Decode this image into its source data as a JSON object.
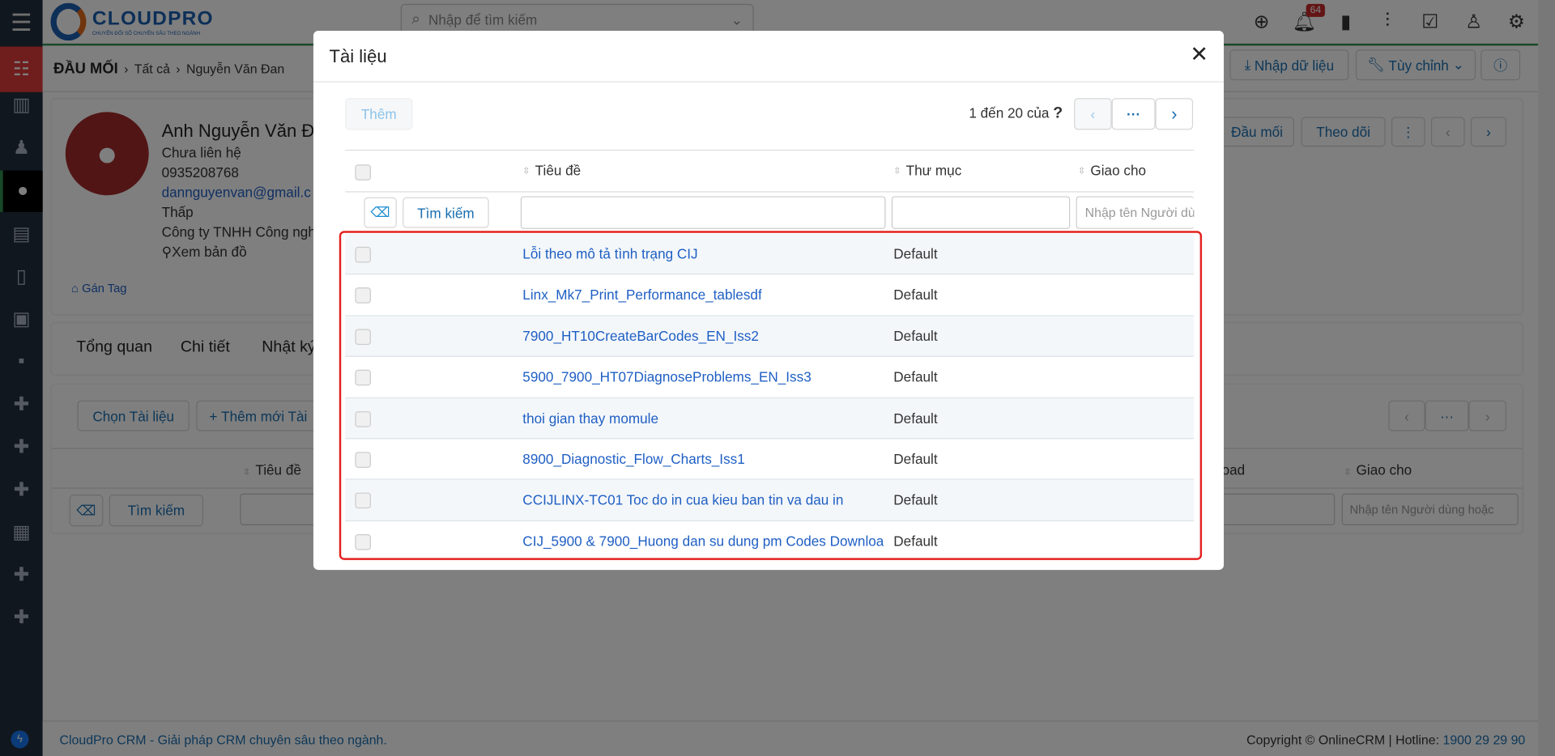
{
  "app": {
    "logo_text": "CLOUDPRO",
    "logo_tagline": "CHUYỂN ĐỔI SỐ CHUYÊN SÂU THEO NGÀNH",
    "search_placeholder": "Nhập để tìm kiếm",
    "notification_count": "64"
  },
  "breadcrumb": [
    "ĐẦU MỐI",
    "Tất cả",
    "Nguyễn Văn Đan"
  ],
  "header_buttons": {
    "import": "Nhập dữ liệu",
    "customize": "Tùy chỉnh"
  },
  "profile": {
    "name": "Anh Nguyễn Văn Đ",
    "status": "Chưa liên hệ",
    "phone": "0935208768",
    "email": "dannguyenvan@gmail.c",
    "priority": "Thấp",
    "company": "Công ty TNHH Công ngh",
    "map": "Xem bản đồ",
    "tag": "Gán Tag",
    "btn_lead": "Đầu mối",
    "btn_follow": "Theo dõi"
  },
  "tabs": [
    "Tổng quan",
    "Chi tiết",
    "Nhật ký"
  ],
  "docs_section": {
    "choose": "Chọn Tài liệu",
    "add_new": "Thêm mới Tài",
    "col_title": "Tiêu đề",
    "col_download": "oad",
    "col_assign": "Giao cho",
    "search": "Tìm kiếm",
    "assign_placeholder": "Nhập tên Người dùng hoặc"
  },
  "footer": {
    "left": "CloudPro CRM - Giải pháp CRM chuyên sâu theo ngành.",
    "right": "Copyright © OnlineCRM | Hotline: ",
    "hotline": "1900 29 29 90"
  },
  "modal": {
    "title": "Tài liệu",
    "add": "Thêm",
    "pagination": "1 đến 20 của",
    "pagination_total": "?",
    "dots": "···",
    "columns": {
      "title": "Tiêu đề",
      "folder": "Thư mục",
      "assign": "Giao cho"
    },
    "search": "Tìm kiếm",
    "assign_placeholder": "Nhập tên Người dùng",
    "rows": [
      {
        "title": "Lỗi theo mô tả tình trạng CIJ",
        "folder": "Default"
      },
      {
        "title": "Linx_Mk7_Print_Performance_tablesdf",
        "folder": "Default"
      },
      {
        "title": "7900_HT10CreateBarCodes_EN_Iss2",
        "folder": "Default"
      },
      {
        "title": "5900_7900_HT07DiagnoseProblems_EN_Iss3",
        "folder": "Default"
      },
      {
        "title": "thoi gian thay momule",
        "folder": "Default"
      },
      {
        "title": "8900_Diagnostic_Flow_Charts_Iss1",
        "folder": "Default"
      },
      {
        "title": "CCIJLINX-TC01 Toc do in cua kieu ban tin va dau in",
        "folder": "Default"
      },
      {
        "title": "CIJ_5900 & 7900_Huong dan su dung pm Codes Downloa",
        "folder": "Default"
      }
    ]
  },
  "colors": {
    "accent": "#1f5fc4",
    "highlight": "#e3211f",
    "avatar": "#a52a2a"
  }
}
